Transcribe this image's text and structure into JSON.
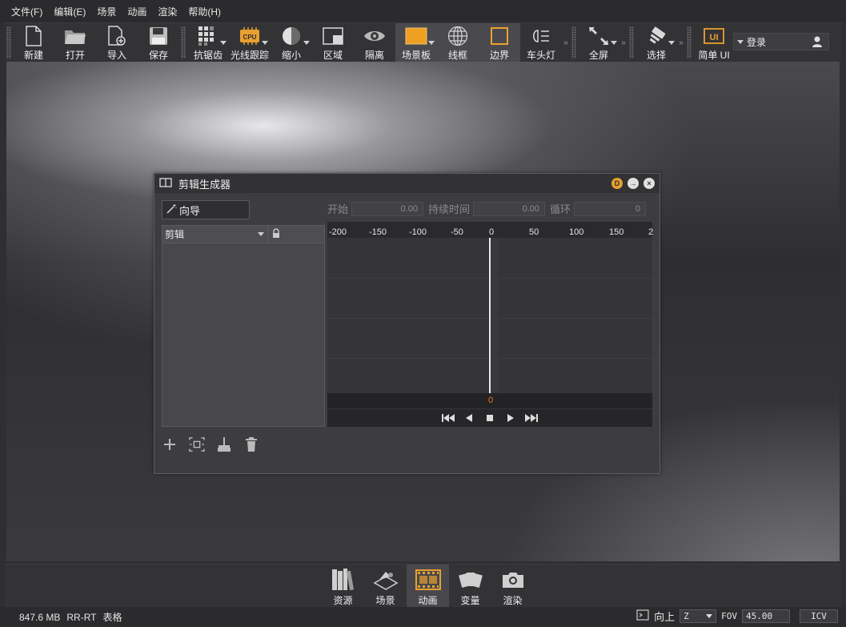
{
  "menu": [
    "文件(F)",
    "编辑(E)",
    "场景",
    "动画",
    "渲染",
    "帮助(H)"
  ],
  "toolbar": {
    "items": [
      {
        "label": "新建",
        "icon": "new-file-icon"
      },
      {
        "label": "打开",
        "icon": "open-folder-icon"
      },
      {
        "label": "导入",
        "icon": "import-icon"
      },
      {
        "label": "保存",
        "icon": "save-icon"
      },
      {
        "label": "抗锯齿",
        "icon": "antialias-icon"
      },
      {
        "label": "光线跟踪",
        "icon": "cpu-icon",
        "cpu_text": "CPU"
      },
      {
        "label": "缩小",
        "icon": "shrink-icon"
      },
      {
        "label": "区域",
        "icon": "region-icon"
      },
      {
        "label": "隔离",
        "icon": "isolate-eye-icon"
      },
      {
        "label": "场景板",
        "icon": "backplate-icon"
      },
      {
        "label": "线框",
        "icon": "wireframe-icon"
      },
      {
        "label": "边界",
        "icon": "bounds-icon"
      },
      {
        "label": "车头灯",
        "icon": "headlight-icon"
      },
      {
        "label": "全屏",
        "icon": "fullscreen-icon"
      },
      {
        "label": "选择",
        "icon": "select-icon"
      },
      {
        "label": "简单 UI",
        "icon": "simple-ui-icon",
        "ui_text": "UI"
      }
    ],
    "login_label": "登录"
  },
  "dialog": {
    "title": "剪辑生成器",
    "wizard_label": "向导",
    "clip_column": "剪辑",
    "start_label": "开始",
    "start_value": "0.00",
    "duration_label": "持续时间",
    "duration_value": "0.00",
    "loop_label": "循环",
    "loop_value": "0",
    "ruler": [
      "-200",
      "-150",
      "-100",
      "-50",
      "0",
      "50",
      "100",
      "150",
      "2"
    ],
    "current_frame": "0",
    "title_buttons": [
      "D",
      "→",
      "×"
    ]
  },
  "dock": {
    "tabs": [
      {
        "label": "资源",
        "icon": "library-books-icon"
      },
      {
        "label": "场景",
        "icon": "scene-icon"
      },
      {
        "label": "动画",
        "icon": "film-strip-icon",
        "active": true
      },
      {
        "label": "变量",
        "icon": "variant-cards-icon"
      },
      {
        "label": "渲染",
        "icon": "camera-icon"
      }
    ]
  },
  "status": {
    "memory": "847.6 MB",
    "renderer": "RR-RT",
    "mode": "表格",
    "up_label": "向上",
    "up_axis": "Z",
    "fov_label": "FOV",
    "fov_value": "45.00",
    "icv_label": "ICV"
  },
  "colors": {
    "accent_orange": "#e8a030",
    "background": "#2f2f32"
  }
}
